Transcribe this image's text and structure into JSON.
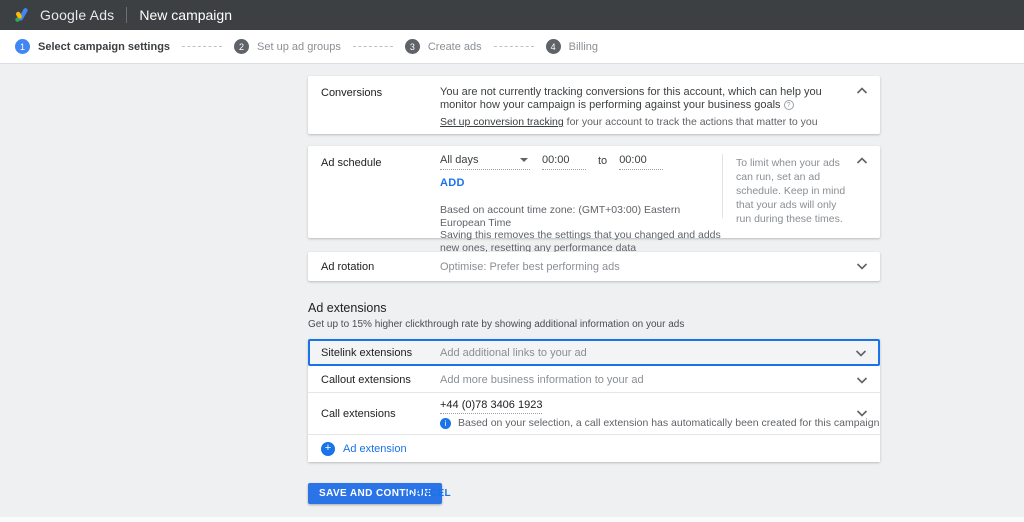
{
  "topbar": {
    "brand": "Google Ads",
    "page_title": "New campaign"
  },
  "stepper": {
    "steps": [
      {
        "number": "1",
        "label": "Select campaign settings"
      },
      {
        "number": "2",
        "label": "Set up ad groups"
      },
      {
        "number": "3",
        "label": "Create ads"
      },
      {
        "number": "4",
        "label": "Billing"
      }
    ]
  },
  "conversions": {
    "label": "Conversions",
    "body": "You are not currently tracking conversions for this account, which can help you monitor how your campaign is performing against your business goals",
    "help_icon_glyph": "?",
    "link_text": "Set up conversion tracking",
    "link_suffix": " for your account to track the actions that matter to you"
  },
  "ad_schedule": {
    "label": "Ad schedule",
    "days_value": "All days",
    "start_time": "00:00",
    "to_label": "to",
    "end_time": "00:00",
    "add_label": "ADD",
    "timezone_note": "Based on account time zone: (GMT+03:00) Eastern European Time",
    "warning_note": "Saving this removes the settings that you changed and adds new ones, resetting any performance data",
    "side_note": "To limit when your ads can run, set an ad schedule. Keep in mind that your ads will only run during these times."
  },
  "ad_rotation": {
    "label": "Ad rotation",
    "value": "Optimise: Prefer best performing ads"
  },
  "ad_extensions": {
    "title": "Ad extensions",
    "subtitle": "Get up to 15% higher clickthrough rate by showing additional information on your ads",
    "sitelink": {
      "label": "Sitelink extensions",
      "value": "Add additional links to your ad"
    },
    "callout": {
      "label": "Callout extensions",
      "value": "Add more business information to your ad"
    },
    "call": {
      "label": "Call extensions",
      "phone": "+44 (0)78 3406 1923",
      "info_icon_glyph": "i",
      "note": "Based on your selection, a call extension has automatically been created for this campaign"
    },
    "add_icon_glyph": "+",
    "add_label": "Ad extension"
  },
  "footer": {
    "save_label": "SAVE AND CONTINUE",
    "cancel_label": "CANCEL"
  },
  "colors": {
    "topbar_bg": "#3c4043",
    "accent_blue": "#1a73e8",
    "step_active": "#4285f4",
    "step_inactive": "#5f6368",
    "page_bg": "#eef0f1"
  }
}
